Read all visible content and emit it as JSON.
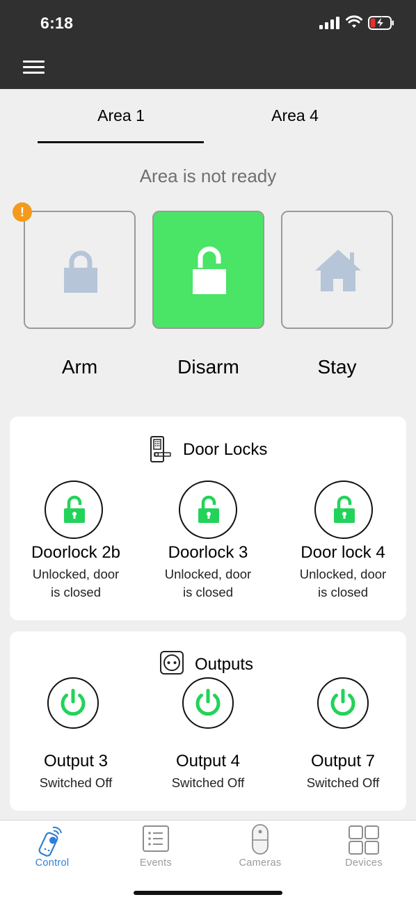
{
  "status_bar": {
    "time": "6:18"
  },
  "tabs": [
    {
      "label": "Area 1",
      "selected": true
    },
    {
      "label": "Area 4",
      "selected": false
    }
  ],
  "area_status": "Area is not ready",
  "warning_badge": "!",
  "modes": [
    {
      "label": "Arm",
      "icon": "lock-closed-icon",
      "active": false
    },
    {
      "label": "Disarm",
      "icon": "lock-open-icon",
      "active": true
    },
    {
      "label": "Stay",
      "icon": "house-icon",
      "active": false
    }
  ],
  "door_locks": {
    "title": "Door Locks",
    "items": [
      {
        "name": "Doorlock 2b",
        "status_line1": "Unlocked, door",
        "status_line2": "is closed"
      },
      {
        "name": "Doorlock 3",
        "status_line1": "Unlocked, door",
        "status_line2": "is closed"
      },
      {
        "name": "Door lock 4",
        "status_line1": "Unlocked, door",
        "status_line2": "is closed"
      }
    ]
  },
  "outputs": {
    "title": "Outputs",
    "items": [
      {
        "name": "Output 3",
        "status": "Switched Off"
      },
      {
        "name": "Output 4",
        "status": "Switched Off"
      },
      {
        "name": "Output 7",
        "status": "Switched Off"
      }
    ]
  },
  "bottom_nav": [
    {
      "label": "Control",
      "icon": "remote-control-icon",
      "active": true
    },
    {
      "label": "Events",
      "icon": "list-icon",
      "active": false
    },
    {
      "label": "Cameras",
      "icon": "camera-icon",
      "active": false
    },
    {
      "label": "Devices",
      "icon": "grid-icon",
      "active": false
    }
  ],
  "colors": {
    "header_bg": "#303030",
    "active_green": "#4ae466",
    "icon_green": "#22d35a",
    "warning_orange": "#f39a1d",
    "nav_active_blue": "#2f7fd6",
    "inactive_icon": "#b6c5d8"
  }
}
